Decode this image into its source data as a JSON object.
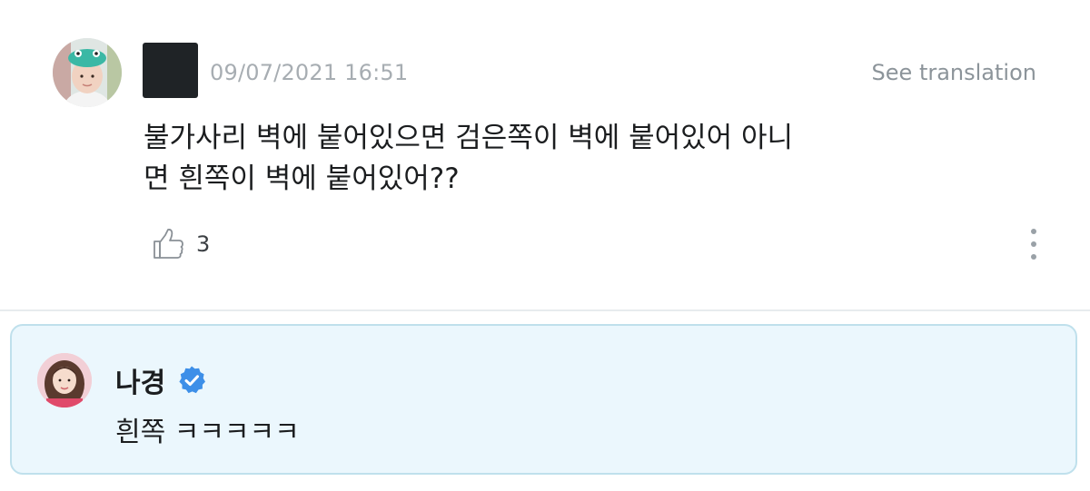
{
  "comment": {
    "timestamp": "09/07/2021 16:51",
    "translate_label": "See translation",
    "text_lines": [
      "불가사리 벽에 붙어있으면 검은쪽이 벽에 붙어있어 아니",
      "면 흰쪽이 벽에 붙어있어??"
    ],
    "like_count": "3",
    "icons": {
      "like": "thumbs-up-icon",
      "more": "more-vertical-icon"
    }
  },
  "reply": {
    "author": "나경",
    "text": "흰쪽 ㅋㅋㅋㅋㅋ",
    "verified": true,
    "icons": {
      "verified": "verified-badge-icon"
    }
  },
  "colors": {
    "reply_background": "#ebf7fd",
    "reply_border": "#bfe0ec",
    "verified_badge": "#3d8fe8",
    "timestamp_text": "#a7adb2"
  }
}
